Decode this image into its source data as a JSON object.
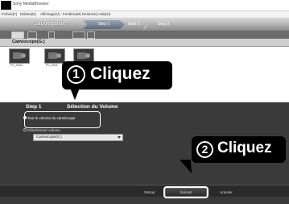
{
  "window": {
    "title": "Sony MediaBrowser"
  },
  "menu": [
    {
      "label": "Fichier(F)"
    },
    {
      "label": "Edition(E)"
    },
    {
      "label": "Affichage(V)"
    },
    {
      "label": "Fenêtre(W)"
    },
    {
      "label": "Rester(S)"
    },
    {
      "label": "Aide(H)"
    }
  ],
  "header": {
    "title": "Sauvegarde",
    "steps": [
      "Step 1",
      "Step 2",
      "Step 3"
    ]
  },
  "source": {
    "label": "Camescope(G:)"
  },
  "files": [
    {
      "name": "PC_0043"
    },
    {
      "name": "PC_0044"
    },
    {
      "name": ""
    }
  ],
  "panel": {
    "step_label": "Step 1",
    "title": "Sélection du Volume",
    "option1": "Tout le volume du caméscope",
    "option2": "Sélectionner volume",
    "dropdown_value": "Camescope(G:)"
  },
  "callouts": {
    "one_num": "1",
    "one_text": "Cliquez",
    "two_num": "2",
    "two_text": "Cliquez"
  },
  "buttons": {
    "back": "Retour",
    "next": "Suivant",
    "cancel": "Annuler"
  }
}
